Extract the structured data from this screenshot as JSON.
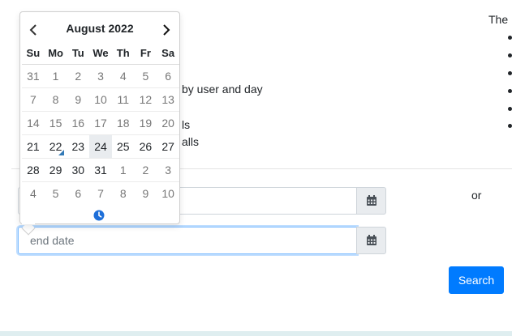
{
  "background": {
    "top_right_text": "The",
    "line_1": "by user and day",
    "line_2": "ls",
    "line_3": "alls",
    "or_label": "or"
  },
  "form": {
    "start_date_value": "",
    "end_date_placeholder": "end date",
    "search_label": "Search"
  },
  "datepicker": {
    "month_year": "August 2022",
    "weekdays": [
      "Su",
      "Mo",
      "Tu",
      "We",
      "Th",
      "Fr",
      "Sa"
    ],
    "weeks": [
      [
        "31",
        "1",
        "2",
        "3",
        "4",
        "5",
        "6"
      ],
      [
        "7",
        "8",
        "9",
        "10",
        "11",
        "12",
        "13"
      ],
      [
        "14",
        "15",
        "16",
        "17",
        "18",
        "19",
        "20"
      ],
      [
        "21",
        "22",
        "23",
        "24",
        "25",
        "26",
        "27"
      ],
      [
        "28",
        "29",
        "30",
        "31",
        "1",
        "2",
        "3"
      ],
      [
        "4",
        "5",
        "6",
        "7",
        "8",
        "9",
        "10"
      ]
    ],
    "today": "22",
    "selected": "24",
    "icons": {
      "prev": "chevron-left-icon",
      "next": "chevron-right-icon",
      "time": "clock-icon",
      "calendar": "calendar-icon"
    }
  },
  "colors": {
    "accent": "#007bff",
    "today_marker": "#337ab7",
    "selected_bg": "#e9ecef",
    "focus_border": "#80bdff"
  }
}
